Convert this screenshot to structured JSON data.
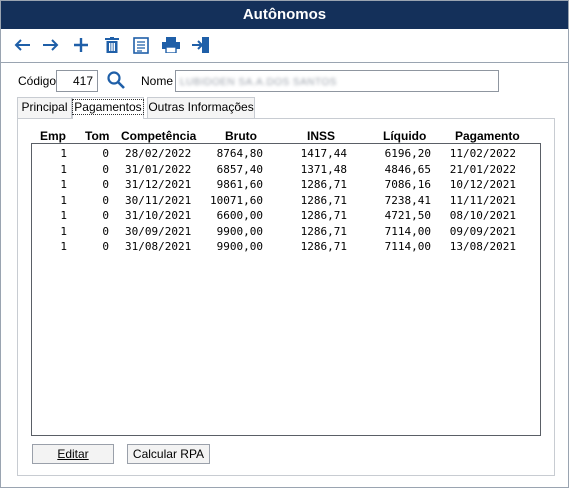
{
  "window": {
    "title": "Autônomos"
  },
  "toolbar": {
    "icons": [
      "back-arrow-icon",
      "forward-arrow-icon",
      "add-icon",
      "delete-icon",
      "document-icon",
      "print-icon",
      "exit-icon"
    ]
  },
  "form": {
    "codigo_label": "Código",
    "codigo_value": "417",
    "nome_label": "Nome",
    "nome_value": "LUBIDOEN SA.A.DOS SANTOS"
  },
  "tabs": [
    {
      "label": "Principal",
      "active": false
    },
    {
      "label": "Pagamentos",
      "active": true
    },
    {
      "label": "Outras Informações",
      "active": false
    }
  ],
  "grid": {
    "columns": [
      "Emp",
      "Tom",
      "Competência",
      "Bruto",
      "INSS",
      "Líquido",
      "Pagamento"
    ],
    "rows": [
      [
        "1",
        "0",
        "28/02/2022",
        "8764,80",
        "1417,44",
        "6196,20",
        "11/02/2022"
      ],
      [
        "1",
        "0",
        "31/01/2022",
        "6857,40",
        "1371,48",
        "4846,65",
        "21/01/2022"
      ],
      [
        "1",
        "0",
        "31/12/2021",
        "9861,60",
        "1286,71",
        "7086,16",
        "10/12/2021"
      ],
      [
        "1",
        "0",
        "30/11/2021",
        "10071,60",
        "1286,71",
        "7238,41",
        "11/11/2021"
      ],
      [
        "1",
        "0",
        "31/10/2021",
        "6600,00",
        "1286,71",
        "4721,50",
        "08/10/2021"
      ],
      [
        "1",
        "0",
        "30/09/2021",
        "9900,00",
        "1286,71",
        "7114,00",
        "09/09/2021"
      ],
      [
        "1",
        "0",
        "31/08/2021",
        "9900,00",
        "1286,71",
        "7114,00",
        "13/08/2021"
      ]
    ]
  },
  "buttons": {
    "editar": "Editar",
    "calcular_rpa": "Calcular RPA"
  },
  "colors": {
    "titlebar": "#14305a",
    "icon_blue": "#1f5fa8"
  }
}
